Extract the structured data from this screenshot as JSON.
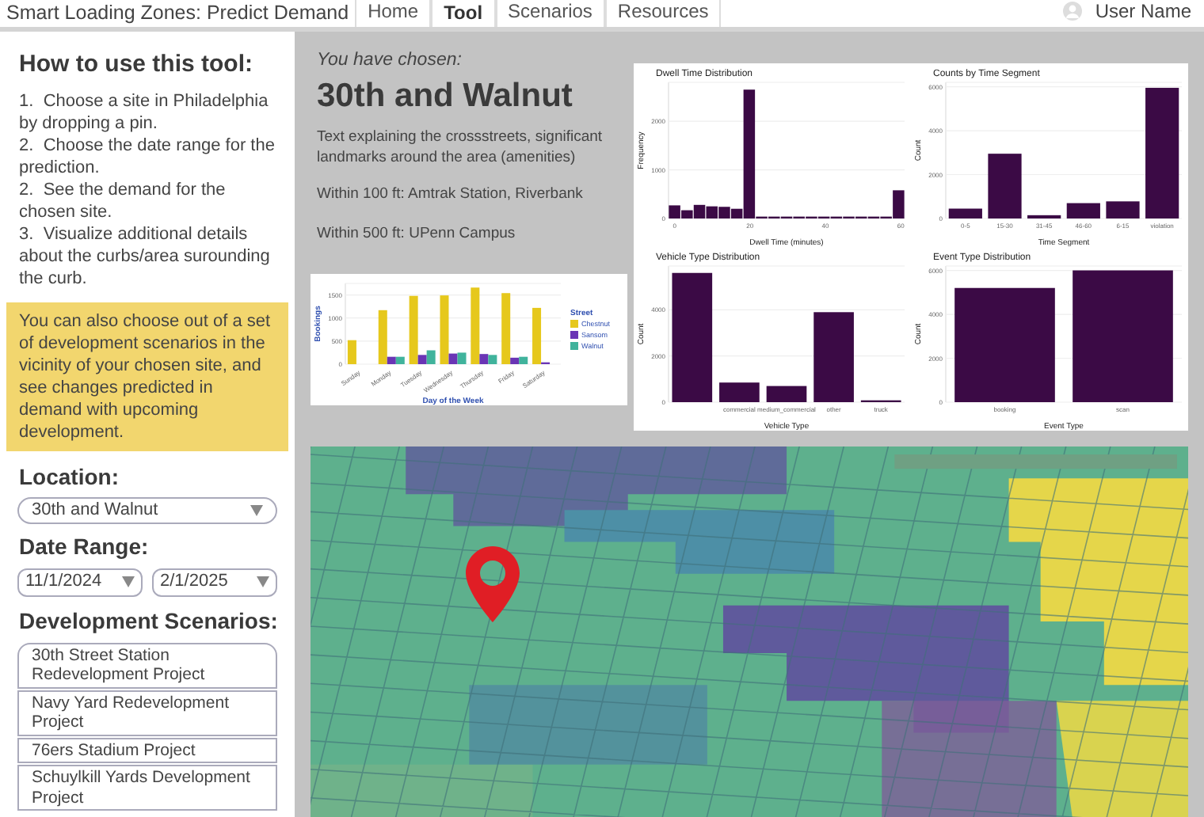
{
  "app_title": "Smart Loading Zones: Predict Demand",
  "tabs": [
    {
      "label": "Home",
      "selected": false
    },
    {
      "label": "Tool",
      "selected": true
    },
    {
      "label": "Scenarios",
      "selected": false
    },
    {
      "label": "Resources",
      "selected": false
    }
  ],
  "user": {
    "name": "User Name"
  },
  "instructions": {
    "title": "How to use this tool:",
    "steps": [
      {
        "number": "1.",
        "text": "Choose a site in Philadelphia by dropping a pin."
      },
      {
        "number": "2.",
        "text": "Choose the date range for the prediction."
      },
      {
        "number": "2.",
        "text": "See the demand for the chosen site."
      },
      {
        "number": "3.",
        "text": "Visualize additional details about the curbs/area surounding the curb."
      }
    ],
    "note": "You can also choose out of a set of development scenarios in the vicinity of your chosen site, and see changes predicted in demand with upcoming development."
  },
  "location": {
    "label": "Location:",
    "value": "30th and Walnut"
  },
  "date_range": {
    "label": "Date Range:",
    "start": "11/1/2024",
    "end": "2/1/2025"
  },
  "scenarios": {
    "label": "Development Scenarios:",
    "items": [
      "30th Street Station Redevelopment Project",
      "Navy Yard Redevelopment Project",
      "76ers Stadium Project",
      "Schuylkill Yards Development Project"
    ]
  },
  "site": {
    "intro": "You have chosen:",
    "name": "30th and Walnut",
    "description": "Text explaining the crossstreets, significant landmarks around the area (amenities)",
    "nearby": [
      "Within 100 ft: Amtrak Station, Riverbank",
      "Within 500 ft: UPenn Campus"
    ]
  },
  "bookings_chart": {
    "chart_data": {
      "type": "bar",
      "xlabel": "Day of the Week",
      "ylabel": "Bookings",
      "categories": [
        "Sunday",
        "Monday",
        "Tuesday",
        "Wednesday",
        "Thursday",
        "Friday",
        "Saturday"
      ],
      "legend_title": "Street",
      "series": [
        {
          "name": "Chestnut",
          "color": "#e6c81c",
          "values": [
            520,
            1170,
            1480,
            1490,
            1660,
            1540,
            1220
          ]
        },
        {
          "name": "Sansom",
          "color": "#6a35b5",
          "values": [
            0,
            160,
            200,
            230,
            220,
            140,
            40
          ]
        },
        {
          "name": "Walnut",
          "color": "#40b39c",
          "values": [
            0,
            160,
            300,
            250,
            200,
            160,
            0
          ]
        }
      ],
      "ylim": [
        0,
        1750
      ],
      "yticks": [
        0,
        500,
        1000,
        1500
      ],
      "grid": true,
      "legend": true
    }
  },
  "detail_charts": [
    {
      "chart_data": {
        "type": "bar",
        "title": "Dwell Time Distribution",
        "xlabel": "Dwell Time (minutes)",
        "ylabel": "Frequency",
        "x": [
          0,
          3.3,
          6.6,
          9.9,
          13.2,
          16.5,
          19.8,
          23.1,
          26.4,
          29.7,
          33,
          36.3,
          39.6,
          42.9,
          46.2,
          49.5,
          52.8,
          56.1,
          59.4
        ],
        "values": [
          270,
          170,
          280,
          250,
          240,
          200,
          2650,
          30,
          30,
          30,
          30,
          30,
          30,
          30,
          30,
          30,
          30,
          30,
          580
        ],
        "xlim": [
          -1.6,
          61
        ],
        "xticks": [
          0,
          20,
          40,
          60
        ],
        "ylim": [
          0,
          2800
        ],
        "yticks": [
          0,
          1000,
          2000
        ],
        "grid": true
      }
    },
    {
      "chart_data": {
        "type": "bar",
        "title": "Counts by Time Segment",
        "xlabel": "Time Segment",
        "ylabel": "Count",
        "categories": [
          "0-5",
          "15-30",
          "31-45",
          "46-60",
          "6-15",
          "violation"
        ],
        "values": [
          450,
          2950,
          150,
          700,
          780,
          5950
        ],
        "ylim": [
          0,
          6200
        ],
        "yticks": [
          0,
          2000,
          4000,
          6000
        ],
        "grid": true
      }
    },
    {
      "chart_data": {
        "type": "bar",
        "title": "Vehicle Type Distribution",
        "xlabel": "Vehicle Type",
        "ylabel": "Count",
        "categories": [
          null,
          "commercial",
          "medium_commercial",
          "other",
          "truck"
        ],
        "values": [
          5600,
          850,
          700,
          3900,
          80
        ],
        "ylim": [
          0,
          5900
        ],
        "yticks": [
          0,
          2000,
          4000
        ],
        "grid": true
      }
    },
    {
      "chart_data": {
        "type": "bar",
        "title": "Event Type Distribution",
        "xlabel": "Event Type",
        "ylabel": "Count",
        "categories": [
          "booking",
          "scan"
        ],
        "values": [
          5200,
          6000
        ],
        "ylim": [
          0,
          6200
        ],
        "yticks": [
          0,
          2000,
          4000,
          6000
        ],
        "grid": true
      }
    }
  ]
}
